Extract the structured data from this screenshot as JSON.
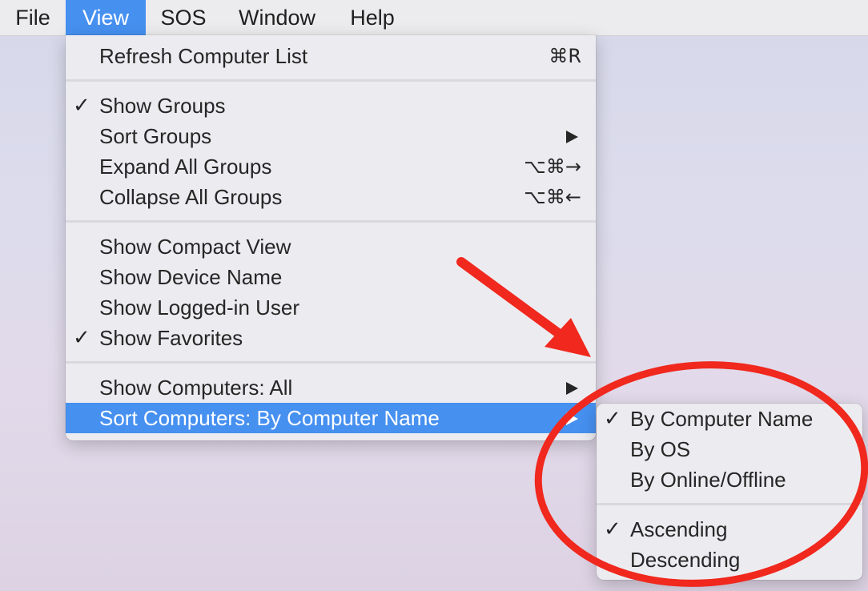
{
  "menubar": {
    "items": [
      {
        "label": "File"
      },
      {
        "label": "View"
      },
      {
        "label": "SOS"
      },
      {
        "label": "Window"
      },
      {
        "label": "Help"
      }
    ],
    "active_index": 1
  },
  "view_menu": {
    "items": [
      {
        "label": "Refresh Computer List",
        "shortcut": "⌘R",
        "checked": false
      },
      {
        "label": "Show Groups",
        "checked": true
      },
      {
        "label": "Sort Groups",
        "has_submenu": true
      },
      {
        "label": "Expand All Groups",
        "shortcut": "⌥⌘→"
      },
      {
        "label": "Collapse All Groups",
        "shortcut": "⌥⌘←"
      },
      {
        "label": "Show Compact View"
      },
      {
        "label": "Show Device Name"
      },
      {
        "label": "Show Logged-in User"
      },
      {
        "label": "Show Favorites",
        "checked": true
      },
      {
        "label": "Show Computers: All",
        "has_submenu": true
      },
      {
        "label": "Sort Computers: By Computer Name",
        "has_submenu": true,
        "highlighted": true
      }
    ]
  },
  "sort_submenu": {
    "items": [
      {
        "label": "By Computer Name",
        "checked": true
      },
      {
        "label": "By OS",
        "checked": false
      },
      {
        "label": "By Online/Offline",
        "checked": false
      },
      {
        "label": "Ascending",
        "checked": true
      },
      {
        "label": "Descending",
        "checked": false
      }
    ]
  },
  "marks": {
    "check_glyph": "✓"
  },
  "annotation": {
    "color": "#f0281e",
    "arrow": "red-arrow-icon",
    "ellipse": "red-circle-highlight"
  },
  "colors": {
    "accent": "#4690f0",
    "menu_bg": "#ececf0",
    "text": "#262626"
  }
}
